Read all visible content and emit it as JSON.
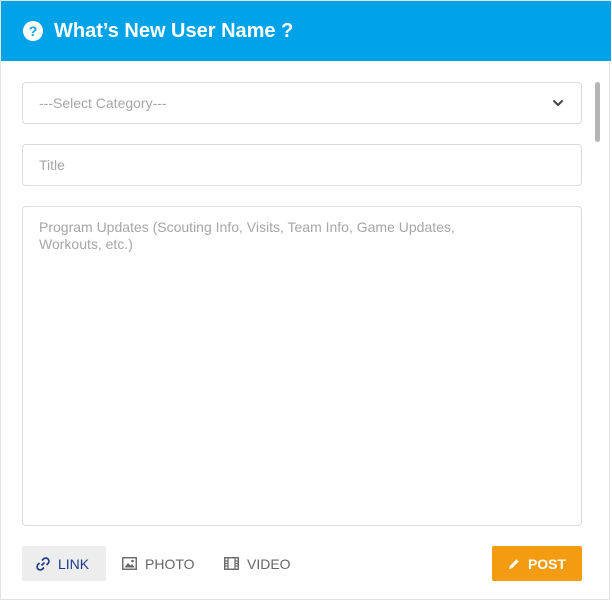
{
  "header": {
    "help_icon": "question-circle-icon",
    "help_glyph": "?",
    "title": "What’s New User Name ?"
  },
  "form": {
    "category_select": {
      "selected": "---Select Category---"
    },
    "title_input": {
      "placeholder": "Title",
      "value": ""
    },
    "body_textarea": {
      "placeholder": "Program Updates (Scouting Info, Visits, Team Info, Game Updates,\nWorkouts, etc.)",
      "value": ""
    }
  },
  "toolbar": {
    "link": {
      "label": "LINK",
      "icon": "link-icon"
    },
    "photo": {
      "label": "PHOTO",
      "icon": "image-icon"
    },
    "video": {
      "label": "VIDEO",
      "icon": "film-icon"
    },
    "post": {
      "label": "POST",
      "icon": "pencil-icon"
    }
  },
  "colors": {
    "header_bg": "#00a3e8",
    "post_bg": "#f39c12",
    "link_text": "#1b3a8a"
  }
}
